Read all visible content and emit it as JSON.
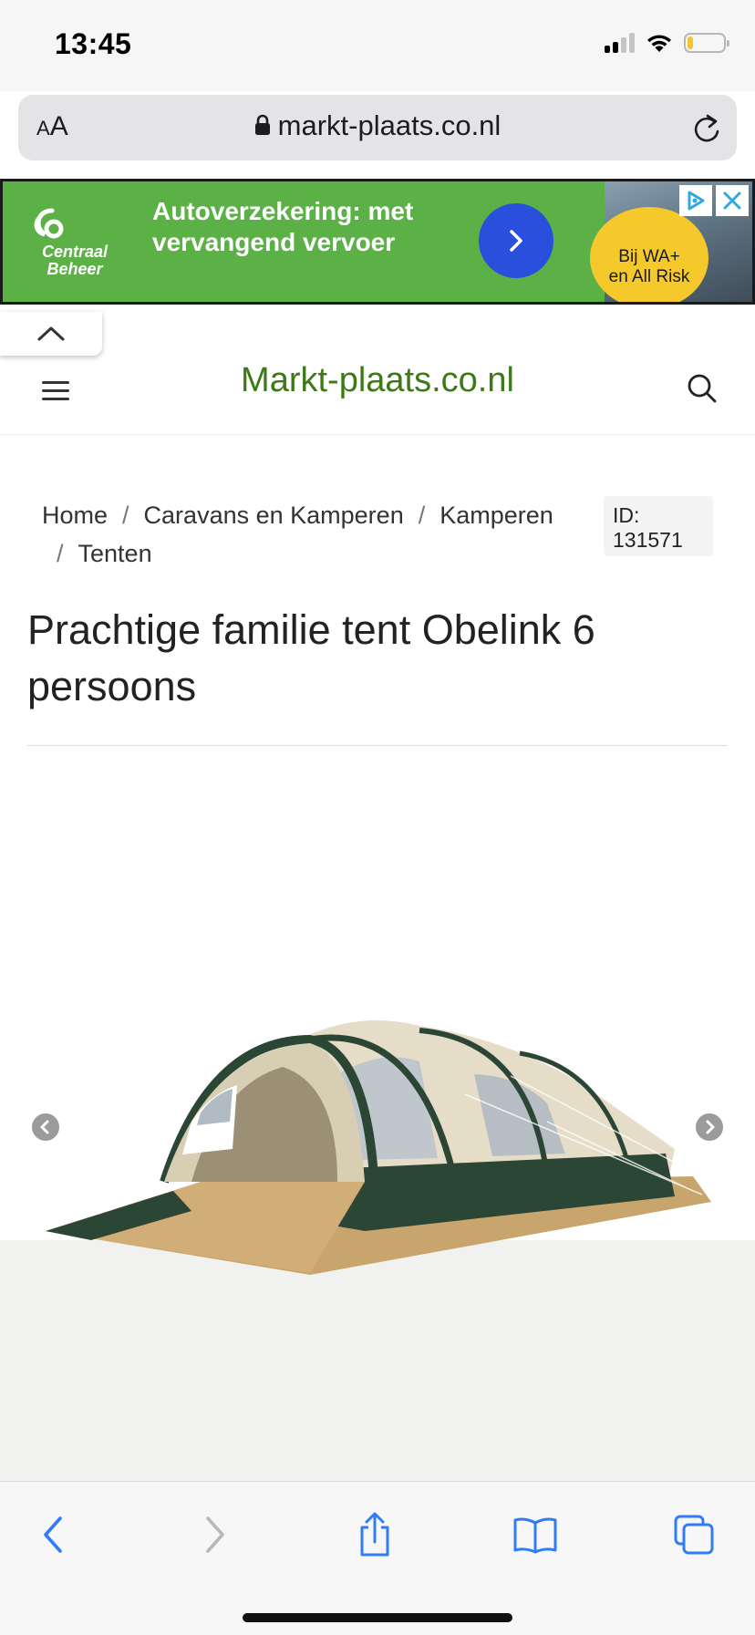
{
  "status_bar": {
    "time": "13:45",
    "icons": [
      "cellular-signal-icon",
      "wifi-icon",
      "battery-icon"
    ],
    "battery_level": 0.15
  },
  "browser": {
    "text_size_button": "AA",
    "url": "markt-plaats.co.nl",
    "toolbar_buttons": [
      "back-icon",
      "forward-icon",
      "share-icon",
      "bookmarks-icon",
      "tabs-icon"
    ]
  },
  "ad": {
    "brand_line1": "Centraal",
    "brand_line2": "Beheer",
    "headline": "Autoverzekering: met vervangend vervoer",
    "badge_line1": "Bij WA+",
    "badge_line2": "en All Risk",
    "colors": {
      "background": "#5cb146",
      "button": "#2a4fdc",
      "badge": "#f5c92b"
    }
  },
  "site": {
    "logo": "Markt-plaats.co.nl",
    "logo_color": "#3d7a17"
  },
  "breadcrumb": {
    "items": [
      "Home",
      "Caravans en Kamperen",
      "Kamperen",
      "Tenten"
    ],
    "separator": "/"
  },
  "listing": {
    "id_label": "ID:",
    "id_value": "131571",
    "title": "Prachtige familie tent Obelink 6 persoons"
  }
}
